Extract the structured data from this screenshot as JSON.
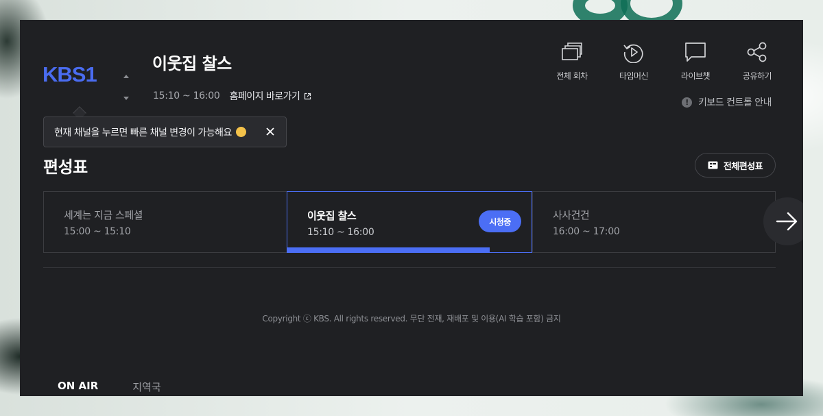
{
  "channel": {
    "logo_text": "KBS1"
  },
  "program": {
    "title": "이웃집 찰스",
    "time": "15:10 ~ 16:00",
    "homepage_link": "홈페이지 바로가기"
  },
  "actions": [
    {
      "label": "전체 회차",
      "icon": "episodes-icon"
    },
    {
      "label": "타임머신",
      "icon": "timemachine-icon"
    },
    {
      "label": "라이브챗",
      "icon": "chat-icon"
    },
    {
      "label": "공유하기",
      "icon": "share-icon"
    }
  ],
  "keyboard_guide": "키보드 컨트롤 안내",
  "tooltip": {
    "text": "현재 채널을 누르면 빠른 채널 변경이 가능해요"
  },
  "schedule": {
    "title": "편성표",
    "full_schedule_label": "전체편성표",
    "items": [
      {
        "title": "세계는 지금 스페셜",
        "time": "15:00 ~ 15:10"
      },
      {
        "title": "이웃집 찰스",
        "time": "15:10 ~ 16:00",
        "badge": "시청중",
        "progress": 0.83
      },
      {
        "title": "사사건건",
        "time": "16:00 ~ 17:00"
      }
    ]
  },
  "footer": {
    "copyright": "Copyright ⓒ KBS. All rights reserved. 무단 전재, 재배포 및 이용(AI 학습 포함) 금지"
  },
  "bottom_tabs": [
    "ON AIR",
    "지역국"
  ],
  "colors": {
    "accent": "#4b6ef5",
    "panel_bg": "#1f2023",
    "logo_blue": "#4a6cf0"
  }
}
